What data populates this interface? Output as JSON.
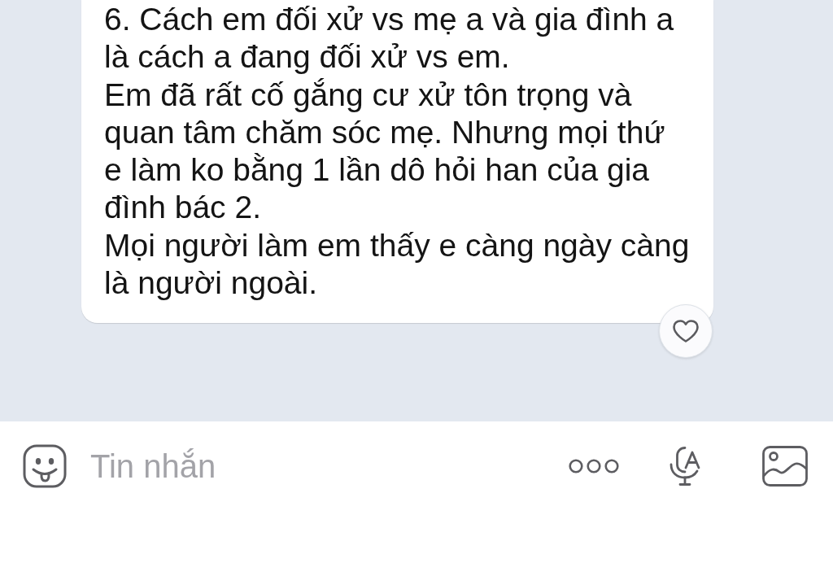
{
  "message": {
    "paragraphs": [
      "6. Cách em đối xử vs mẹ a và gia đình a là cách a đang đối xử vs em.",
      "Em đã rất cố gắng cư xử tôn trọng và quan tâm chăm sóc mẹ. Nhưng mọi thứ e làm ko bằng 1 lần dô hỏi han của gia đình bác 2.",
      "Mọi người làm em thấy e càng ngày càng là người ngoài."
    ]
  },
  "composer": {
    "placeholder": "Tin nhắn"
  }
}
